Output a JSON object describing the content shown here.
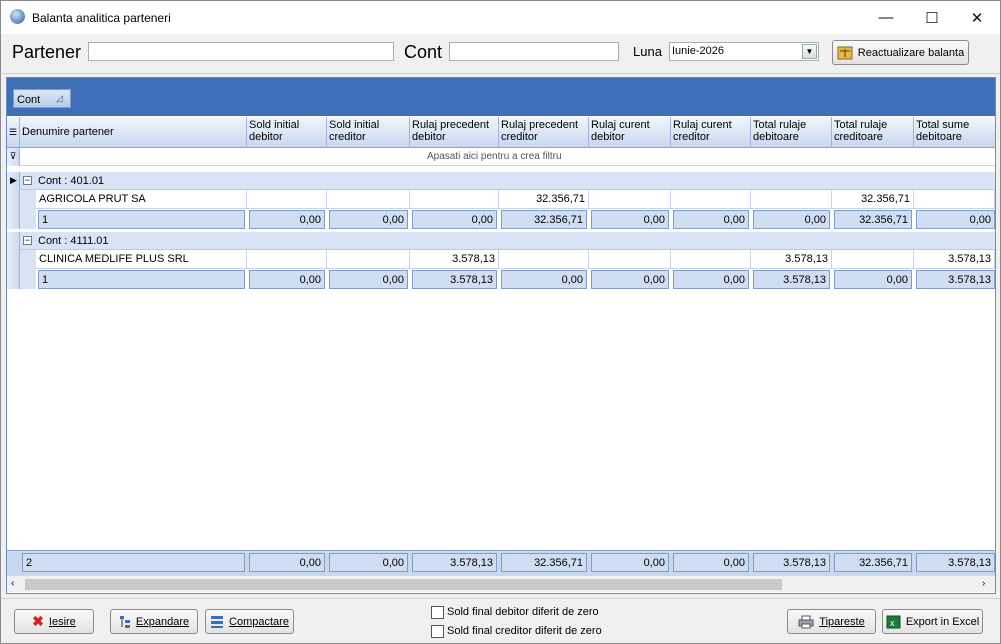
{
  "window": {
    "title": "Balanta analitica parteneri",
    "minimize_glyph": "—",
    "maximize_glyph": "☐",
    "close_glyph": "✕"
  },
  "filters": {
    "partener_label": "Partener",
    "partener_value": "",
    "cont_label": "Cont",
    "cont_value": "",
    "luna_label": "Luna",
    "luna_value": "Iunie-2026",
    "refresh_button": "Reactualizare balanta"
  },
  "grid": {
    "group_chip": "Cont",
    "filter_hint": "Apasati aici pentru a  crea filtru",
    "columns": [
      [
        "Denumire partener",
        ""
      ],
      [
        "Sold initial",
        "debitor"
      ],
      [
        "Sold initial",
        "creditor"
      ],
      [
        "Rulaj precedent",
        "debitor"
      ],
      [
        "Rulaj precedent",
        "creditor"
      ],
      [
        "Rulaj curent",
        "debitor"
      ],
      [
        "Rulaj curent",
        "creditor"
      ],
      [
        "Total rulaje",
        "debitoare"
      ],
      [
        "Total rulaje",
        "creditoare"
      ],
      [
        "Total sume",
        "debitoare"
      ]
    ],
    "groups": [
      {
        "label": "Cont : 401.01",
        "row": [
          "AGRICOLA PRUT SA",
          "",
          "",
          "",
          "32.356,71",
          "",
          "",
          "",
          "32.356,71",
          ""
        ],
        "summary": [
          "1",
          "0,00",
          "0,00",
          "0,00",
          "32.356,71",
          "0,00",
          "0,00",
          "0,00",
          "32.356,71",
          "0,00"
        ]
      },
      {
        "label": "Cont : 4111.01",
        "row": [
          "CLINICA MEDLIFE PLUS SRL",
          "",
          "",
          "3.578,13",
          "",
          "",
          "",
          "3.578,13",
          "",
          "3.578,13"
        ],
        "summary": [
          "1",
          "0,00",
          "0,00",
          "3.578,13",
          "0,00",
          "0,00",
          "0,00",
          "3.578,13",
          "0,00",
          "3.578,13"
        ]
      }
    ],
    "footer": [
      "2",
      "0,00",
      "0,00",
      "3.578,13",
      "32.356,71",
      "0,00",
      "0,00",
      "3.578,13",
      "32.356,71",
      "3.578,13"
    ]
  },
  "bottom": {
    "exit_button": "Iesire",
    "expand_button": "Expandare",
    "compact_button": "Compactare",
    "check_debit": "Sold  final debitor diferit de zero",
    "check_credit": "Sold  final creditor diferit de zero",
    "print_button": "Tipareste",
    "excel_button": "Export in Excel"
  },
  "icons": [
    "app-icon",
    "scale-icon",
    "close-x-icon",
    "expand-icon",
    "compact-icon",
    "printer-icon",
    "excel-icon",
    "filter-icon",
    "column-chooser-icon",
    "row-pointer-icon",
    "sort-icon"
  ]
}
